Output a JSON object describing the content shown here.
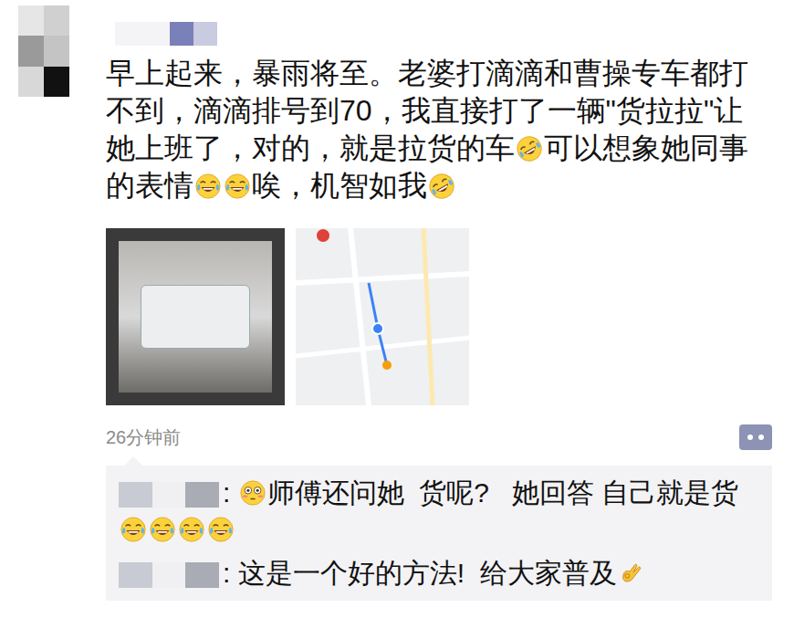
{
  "post": {
    "segments": [
      {
        "kind": "text",
        "text": "早上起来，暴雨将至。老婆打滴滴和曹操专车都打不到，滴滴排号到70，我直接打了一辆\"货拉拉\"让她上班了，对的，就是拉货的车"
      },
      {
        "kind": "rofl"
      },
      {
        "kind": "text",
        "text": "可以想象她同事的表情"
      },
      {
        "kind": "joy"
      },
      {
        "kind": "joy"
      },
      {
        "kind": "text",
        "text": "唉，机智如我"
      },
      {
        "kind": "rofl"
      }
    ]
  },
  "images": [
    {
      "kind": "photo"
    },
    {
      "kind": "map"
    }
  ],
  "time": "26分钟前",
  "comments": [
    {
      "segments": [
        {
          "kind": "text",
          "text": ": "
        },
        {
          "kind": "flushed"
        },
        {
          "kind": "text",
          "text": "师傅还问她  货呢?   她回答 自己就是货"
        },
        {
          "kind": "joy"
        },
        {
          "kind": "joy"
        },
        {
          "kind": "joy"
        },
        {
          "kind": "joy"
        }
      ]
    },
    {
      "segments": [
        {
          "kind": "text",
          "text": ": 这是一个好的方法!  给大家普及"
        },
        {
          "kind": "ok"
        }
      ]
    }
  ]
}
